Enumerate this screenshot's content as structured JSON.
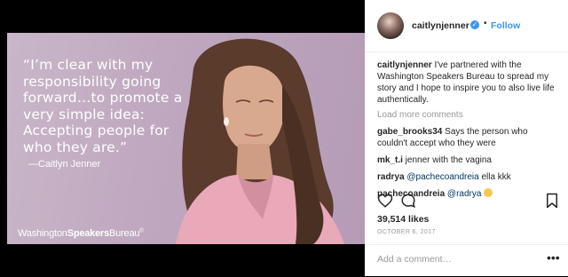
{
  "photo": {
    "quote": "“I’m clear with my responsibility going forward…to promote a very simple idea: Accepting people for who they are.”",
    "quote_author": "—Caitlyn Jenner",
    "brand_regular_1": "Washington",
    "brand_bold": "Speakers",
    "brand_regular_2": "Bureau",
    "brand_mark": "®"
  },
  "post": {
    "username": "caitlynjenner",
    "dot": "•",
    "follow_label": "Follow",
    "caption_user": "caitlynjenner",
    "caption_text": " I've partnered with the Washington Speakers Bureau to spread my story and I hope to inspire you to also live life authentically.",
    "load_more": "Load more comments",
    "comments": [
      {
        "user": "gabe_brooks34",
        "text": " Says the person who couldn't accept who they were"
      },
      {
        "user": "mk_t.i",
        "text": " jenner with the vagina"
      },
      {
        "user": "radrya",
        "mention": " @pachecoandreia",
        "text": " ella kkk"
      },
      {
        "user": "pachecoandreia",
        "mention": " @radrya",
        "text": " "
      }
    ],
    "likes": "39,514 likes",
    "date": "OCTOBER 6, 2017",
    "add_comment_placeholder": "Add a comment…",
    "more_symbol": "•••"
  },
  "icons": {
    "verified": "verified-badge-icon",
    "like": "heart-icon",
    "comment": "comment-bubble-icon",
    "save": "bookmark-icon"
  },
  "colors": {
    "accent": "#3897f0",
    "text": "#262626",
    "muted": "#999999",
    "photo_bg": "#c1aac2"
  }
}
